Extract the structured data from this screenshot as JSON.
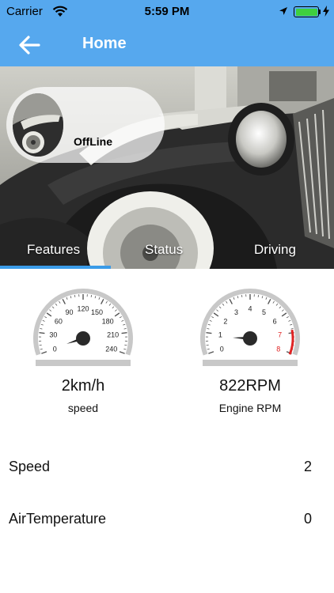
{
  "status_bar": {
    "carrier": "Carrier",
    "time": "5:59 PM"
  },
  "nav": {
    "title": "Home",
    "back_icon": "arrow-left-icon"
  },
  "profile": {
    "state": "OffLine"
  },
  "tabs": [
    {
      "label": "Features"
    },
    {
      "label": "Status"
    },
    {
      "label": "Driving"
    }
  ],
  "active_tab": "Features",
  "gauges": {
    "speed": {
      "value_text": "2km/h",
      "label": "speed",
      "ticks": [
        "0",
        "30",
        "60",
        "90",
        "120",
        "150",
        "180",
        "210",
        "240"
      ],
      "min": 0,
      "max": 240,
      "reading": 2
    },
    "rpm": {
      "value_text": "822RPM",
      "label": "Engine RPM",
      "ticks": [
        "0",
        "1",
        "2",
        "3",
        "4",
        "5",
        "6",
        "7",
        "8"
      ],
      "redline_ticks": [
        "7",
        "8"
      ],
      "min": 0,
      "max": 8,
      "reading": 0.822
    }
  },
  "rows": [
    {
      "label": "Speed",
      "value": "2"
    },
    {
      "label": "AirTemperature",
      "value": "0"
    }
  ],
  "colors": {
    "accent": "#56a8ee",
    "tab_indicator": "#3a9be8",
    "redline": "#e02424",
    "battery": "#3fcf3f"
  }
}
